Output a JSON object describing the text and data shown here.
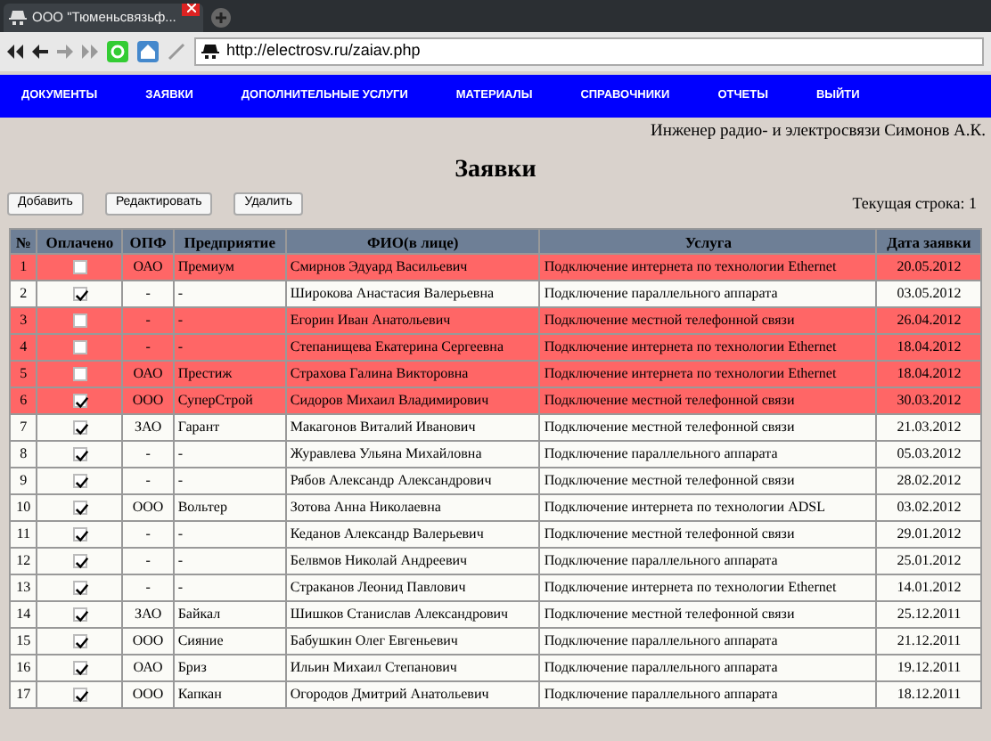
{
  "browser": {
    "tab_title": "ООО \"Тюменьсвязьф...",
    "url": "http://electrosv.ru/zaiav.php"
  },
  "menu": [
    {
      "label": "ДОКУМЕНТЫ"
    },
    {
      "label": "ЗАЯВКИ"
    },
    {
      "label": "ДОПОЛНИТЕЛЬНЫЕ УСЛУГИ"
    },
    {
      "label": "МАТЕРИАЛЫ"
    },
    {
      "label": "СПРАВОЧНИКИ"
    },
    {
      "label": "ОТЧЕТЫ"
    },
    {
      "label": "ВЫЙТИ"
    }
  ],
  "user": "Инженер радио- и электросвязи Симонов А.К.",
  "title": "Заявки",
  "buttons": [
    "Добавить",
    "Редактировать",
    "Удалить"
  ],
  "current_row": "Текущая строка: 1",
  "table": {
    "columns": [
      "№",
      "Оплачено",
      "ОПФ",
      "Предприятие",
      "ФИО(в лице)",
      "Услуга",
      "Дата заявки"
    ],
    "rows": [
      {
        "num": "1",
        "paid": false,
        "highlighted": true,
        "opf": "ОАО",
        "company": "Премиум",
        "fio": "Смирнов Эдуард Васильевич",
        "service": "Подключение интернета по технологии Ethernet",
        "date": "20.05.2012"
      },
      {
        "num": "2",
        "paid": true,
        "highlighted": false,
        "opf": "-",
        "company": "-",
        "fio": "Широкова Анастасия Валерьевна",
        "service": "Подключение параллельного аппарата",
        "date": "03.05.2012"
      },
      {
        "num": "3",
        "paid": false,
        "highlighted": true,
        "opf": "-",
        "company": "-",
        "fio": "Егорин Иван Анатольевич",
        "service": "Подключение местной телефонной связи",
        "date": "26.04.2012"
      },
      {
        "num": "4",
        "paid": false,
        "highlighted": true,
        "opf": "-",
        "company": "-",
        "fio": "Степанищева Екатерина Сергеевна",
        "service": "Подключение интернета по технологии Ethernet",
        "date": "18.04.2012"
      },
      {
        "num": "5",
        "paid": false,
        "highlighted": true,
        "opf": "ОАО",
        "company": "Престиж",
        "fio": "Страхова Галина Викторовна",
        "service": "Подключение интернета по технологии Ethernet",
        "date": "18.04.2012"
      },
      {
        "num": "6",
        "paid": true,
        "highlighted": true,
        "opf": "ООО",
        "company": "СуперСтрой",
        "fio": "Сидоров Михаил Владимирович",
        "service": "Подключение местной телефонной связи",
        "date": "30.03.2012"
      },
      {
        "num": "7",
        "paid": true,
        "highlighted": false,
        "opf": "ЗАО",
        "company": "Гарант",
        "fio": "Макагонов Виталий Иванович",
        "service": "Подключение местной телефонной связи",
        "date": "21.03.2012"
      },
      {
        "num": "8",
        "paid": true,
        "highlighted": false,
        "opf": "-",
        "company": "-",
        "fio": "Журавлева Ульяна Михайловна",
        "service": "Подключение параллельного аппарата",
        "date": "05.03.2012"
      },
      {
        "num": "9",
        "paid": true,
        "highlighted": false,
        "opf": "-",
        "company": "-",
        "fio": "Рябов Александр Александрович",
        "service": "Подключение местной телефонной связи",
        "date": "28.02.2012"
      },
      {
        "num": "10",
        "paid": true,
        "highlighted": false,
        "opf": "ООО",
        "company": "Вольтер",
        "fio": "Зотова Анна Николаевна",
        "service": "Подключение интернета по технологии ADSL",
        "date": "03.02.2012"
      },
      {
        "num": "11",
        "paid": true,
        "highlighted": false,
        "opf": "-",
        "company": "-",
        "fio": "Кеданов Александр Валерьевич",
        "service": "Подключение местной телефонной связи",
        "date": "29.01.2012"
      },
      {
        "num": "12",
        "paid": true,
        "highlighted": false,
        "opf": "-",
        "company": "-",
        "fio": "Белвмов Николай Андреевич",
        "service": "Подключение параллельного аппарата",
        "date": "25.01.2012"
      },
      {
        "num": "13",
        "paid": true,
        "highlighted": false,
        "opf": "-",
        "company": "-",
        "fio": "Страканов Леонид Павлович",
        "service": "Подключение интернета по технологии Ethernet",
        "date": "14.01.2012"
      },
      {
        "num": "14",
        "paid": true,
        "highlighted": false,
        "opf": "ЗАО",
        "company": "Байкал",
        "fio": "Шишков Станислав Александрович",
        "service": "Подключение местной телефонной связи",
        "date": "25.12.2011"
      },
      {
        "num": "15",
        "paid": true,
        "highlighted": false,
        "opf": "ООО",
        "company": "Сияние",
        "fio": "Бабушкин Олег Евгеньевич",
        "service": "Подключение параллельного аппарата",
        "date": "21.12.2011"
      },
      {
        "num": "16",
        "paid": true,
        "highlighted": false,
        "opf": "ОАО",
        "company": "Бриз",
        "fio": "Ильин Михаил Степанович",
        "service": "Подключение параллельного аппарата",
        "date": "19.12.2011"
      },
      {
        "num": "17",
        "paid": true,
        "highlighted": false,
        "opf": "ООО",
        "company": "Капкан",
        "fio": "Огородов Дмитрий Анатольевич",
        "service": "Подключение параллельного аппарата",
        "date": "18.12.2011"
      }
    ]
  }
}
